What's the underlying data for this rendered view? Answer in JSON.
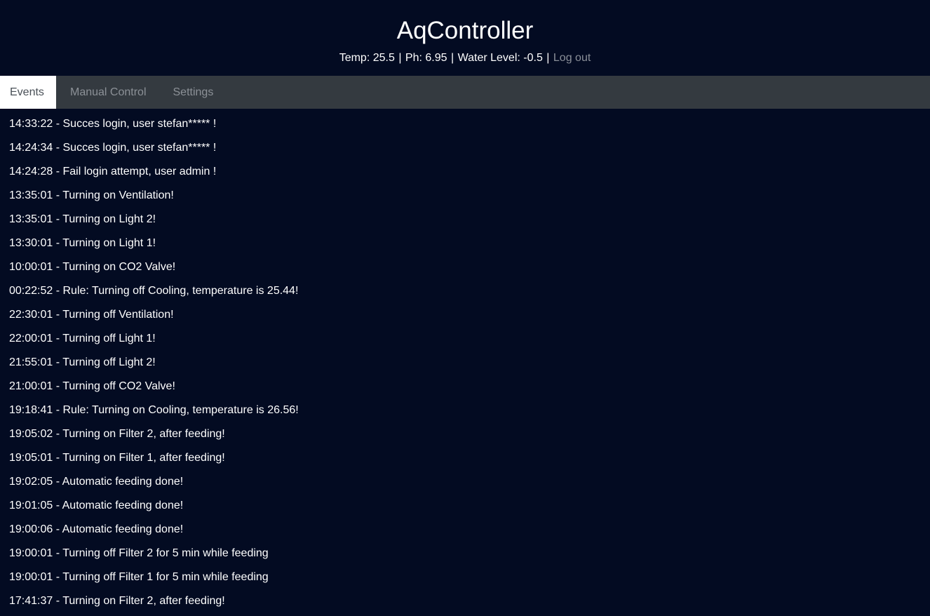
{
  "header": {
    "title": "AqController",
    "temp_label": "Temp:",
    "temp_value": "25.5",
    "ph_label": "Ph:",
    "ph_value": "6.95",
    "water_label": "Water Level:",
    "water_value": "-0.5",
    "separator": "|",
    "logout_label": "Log out"
  },
  "tabs": [
    {
      "label": "Events",
      "active": true
    },
    {
      "label": "Manual Control",
      "active": false
    },
    {
      "label": "Settings",
      "active": false
    }
  ],
  "events": [
    "14:33:22 - Succes login, user stefan***** !",
    "14:24:34 - Succes login, user stefan***** !",
    "14:24:28 - Fail login attempt, user admin !",
    "13:35:01 - Turning on Ventilation!",
    "13:35:01 - Turning on Light 2!",
    "13:30:01 - Turning on Light 1!",
    "10:00:01 - Turning on CO2 Valve!",
    "00:22:52 - Rule: Turning off Cooling, temperature is 25.44!",
    "22:30:01 - Turning off Ventilation!",
    "22:00:01 - Turning off Light 1!",
    "21:55:01 - Turning off Light 2!",
    "21:00:01 - Turning off CO2 Valve!",
    "19:18:41 - Rule: Turning on Cooling, temperature is 26.56!",
    "19:05:02 - Turning on Filter 2, after feeding!",
    "19:05:01 - Turning on Filter 1, after feeding!",
    "19:02:05 - Automatic feeding done!",
    "19:01:05 - Automatic feeding done!",
    "19:00:06 - Automatic feeding done!",
    "19:00:01 - Turning off Filter 2 for 5 min while feeding",
    "19:00:01 - Turning off Filter 1 for 5 min while feeding",
    "17:41:37 - Turning on Filter 2, after feeding!"
  ],
  "colors": {
    "background": "#030b22",
    "tabbar": "#343a40",
    "active_tab": "#ffffff",
    "muted_text": "#8a8f98"
  }
}
